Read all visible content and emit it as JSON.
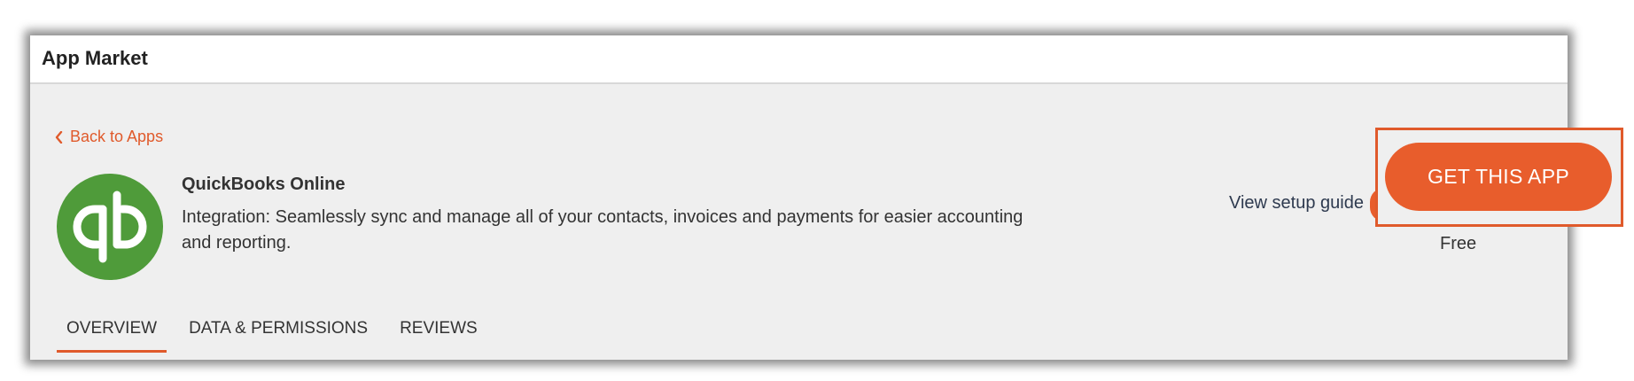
{
  "window": {
    "title": "App Market"
  },
  "navigation": {
    "back_label": "Back to Apps",
    "back_icon": "chevron-left-icon"
  },
  "app": {
    "name": "QuickBooks Online",
    "description": "Integration: Seamlessly sync and manage all of your contacts, invoices and payments for easier accounting and reporting.",
    "logo_icon": "quickbooks-logo",
    "logo_color": "#4f9b3a"
  },
  "actions": {
    "setup_guide_label": "View setup guide",
    "get_app_label": "GET THIS APP",
    "price": "Free"
  },
  "tabs": [
    {
      "label": "OVERVIEW",
      "active": true
    },
    {
      "label": "DATA & PERMISSIONS",
      "active": false
    },
    {
      "label": "REVIEWS",
      "active": false
    }
  ],
  "colors": {
    "accent": "#e05a2b",
    "button": "#e85d2c",
    "panel_background": "#efefef"
  }
}
